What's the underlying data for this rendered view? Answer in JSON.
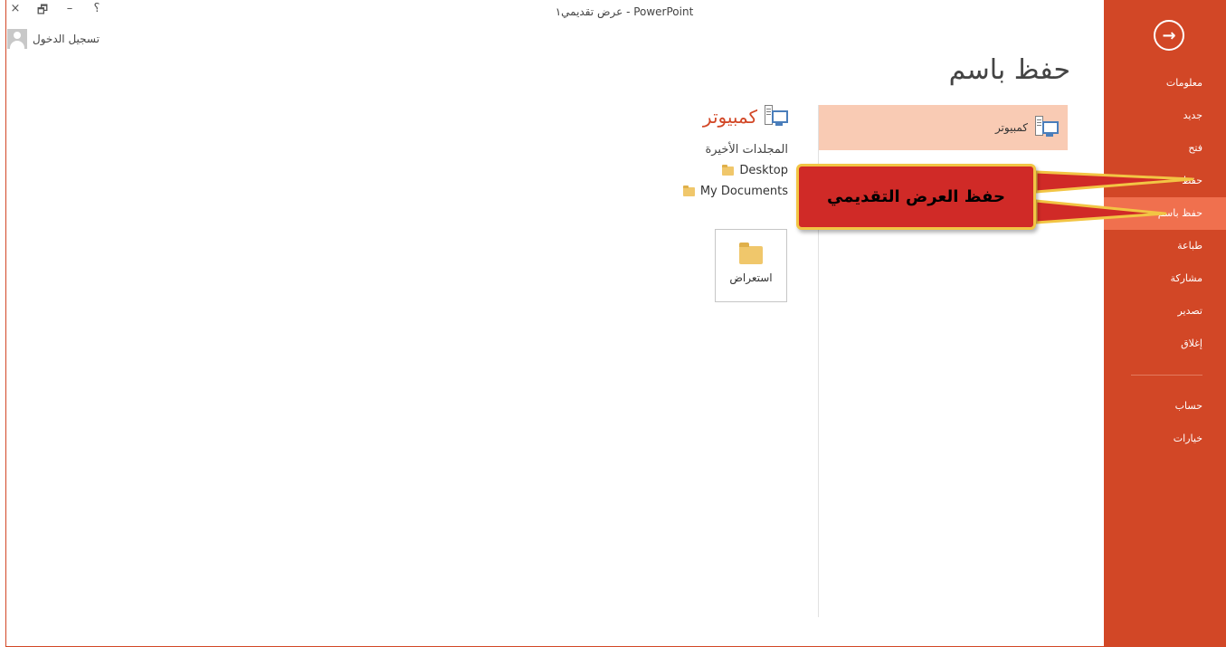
{
  "window": {
    "title": "عرض تقديمي١ - PowerPoint",
    "controls": {
      "close": "×",
      "restore": "🗗",
      "minimize": "–",
      "help": "؟"
    }
  },
  "account": {
    "signin_label": "تسجيل الدخول"
  },
  "sidebar": {
    "back_icon": "arrow-right-circle-icon",
    "items": [
      {
        "label": "معلومات"
      },
      {
        "label": "جديد"
      },
      {
        "label": "فتح"
      },
      {
        "label": "حفظ"
      },
      {
        "label": "حفظ باسم",
        "active": true
      },
      {
        "label": "طباعة"
      },
      {
        "label": "مشاركة"
      },
      {
        "label": "تصدير"
      },
      {
        "label": "إغلاق"
      }
    ],
    "footer_items": [
      {
        "label": "حساب"
      },
      {
        "label": "خيارات"
      }
    ],
    "color": "#d24726",
    "active_color": "#f0704e"
  },
  "main": {
    "title": "حفظ باسم",
    "places": [
      {
        "label": "كمبيوتر",
        "selected": true
      }
    ],
    "computer": {
      "heading": "كمبيوتر",
      "recent_folders_label": "المجلدات الأخيرة",
      "folders": [
        {
          "name": "Desktop"
        },
        {
          "name": "My Documents"
        }
      ],
      "browse_label": "استعراض"
    }
  },
  "callout": {
    "text": "حفظ العرض التقديمي",
    "fill": "#d02a27",
    "border": "#f2c544"
  }
}
